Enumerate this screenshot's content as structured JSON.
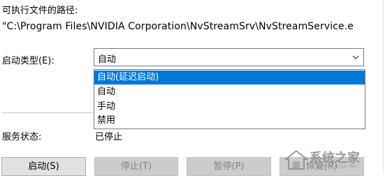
{
  "executable": {
    "label": "可执行文件的路径:",
    "path": "\"C:\\Program Files\\NVIDIA Corporation\\NvStreamSrv\\NvStreamService.e"
  },
  "startup_type": {
    "label": "启动类型(E):",
    "selected": "自动",
    "options": [
      "自动(延迟启动)",
      "自动",
      "手动",
      "禁用"
    ],
    "highlighted_index": 0
  },
  "service_status": {
    "label": "服务状态:",
    "value": "已停止"
  },
  "buttons": {
    "start": "启动(S)",
    "stop": "停止(T)",
    "pause": "暂停(P)",
    "resume": "恢复(R)"
  },
  "watermark": {
    "text": "系统之家",
    "url": "XITONGZHIJIA.NET"
  },
  "colors": {
    "highlight": "#0078d7",
    "border": "#7a7a7a",
    "button_bg": "#e1e1e1"
  }
}
